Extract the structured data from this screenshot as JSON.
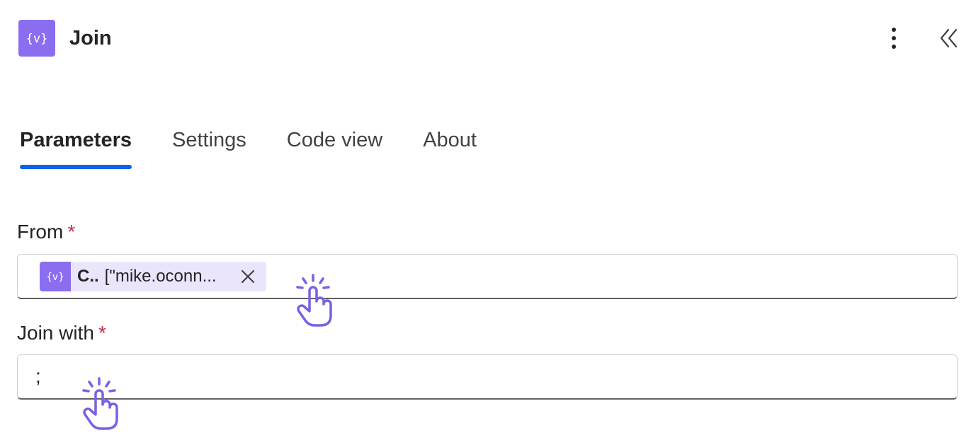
{
  "header": {
    "title": "Join",
    "icon": "variable-braces-icon",
    "accent_color": "#8b6ef0"
  },
  "toolbar": {
    "more_icon": "more-vertical-icon",
    "collapse_icon": "double-chevron-left-icon"
  },
  "tabs": [
    {
      "label": "Parameters",
      "active": true
    },
    {
      "label": "Settings",
      "active": false
    },
    {
      "label": "Code view",
      "active": false
    },
    {
      "label": "About",
      "active": false
    }
  ],
  "tab_indicator_color": "#0f62e6",
  "fields": {
    "from": {
      "label": "From",
      "required_mark": "*",
      "token": {
        "prefix": "C..",
        "text": "[\"mike.oconn...",
        "icon": "variable-braces-icon"
      }
    },
    "join_with": {
      "label": "Join with",
      "required_mark": "*",
      "value": ";"
    }
  }
}
